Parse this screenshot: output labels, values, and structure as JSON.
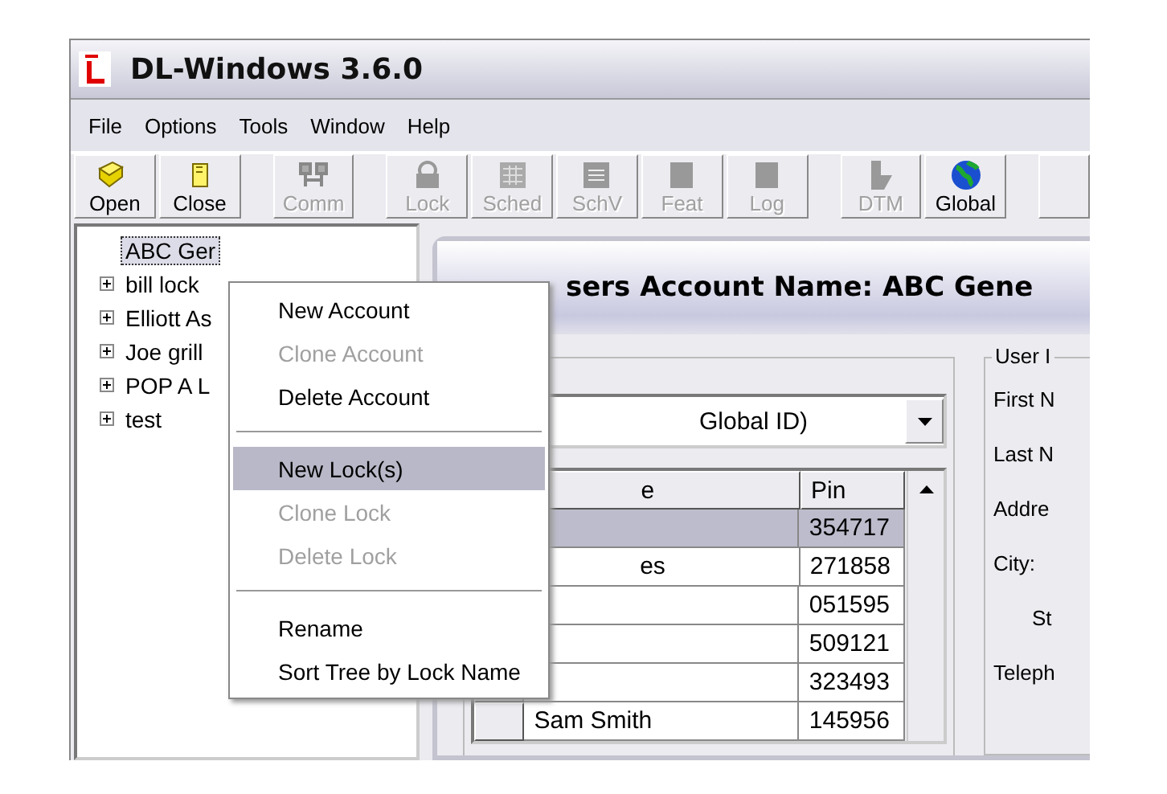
{
  "window": {
    "title": "DL-Windows 3.6.0"
  },
  "menu_bar": [
    "File",
    "Options",
    "Tools",
    "Window",
    "Help"
  ],
  "toolbar": [
    {
      "label": "Open",
      "disabled": false,
      "group_start": false
    },
    {
      "label": "Close",
      "disabled": false,
      "group_start": false
    },
    {
      "label": "Comm",
      "disabled": true,
      "group_start": true
    },
    {
      "label": "Lock",
      "disabled": true,
      "group_start": true
    },
    {
      "label": "Sched",
      "disabled": true,
      "group_start": false
    },
    {
      "label": "SchV",
      "disabled": true,
      "group_start": false
    },
    {
      "label": "Feat",
      "disabled": true,
      "group_start": false
    },
    {
      "label": "Log",
      "disabled": true,
      "group_start": false
    },
    {
      "label": "DTM",
      "disabled": true,
      "group_start": true
    },
    {
      "label": "Global",
      "disabled": false,
      "group_start": false
    }
  ],
  "tree": [
    {
      "label": "ABC Ger",
      "selected": true
    },
    {
      "label": "bill lock",
      "selected": false,
      "expanded": false
    },
    {
      "label": "Elliott As",
      "selected": false,
      "expanded": false
    },
    {
      "label": "Joe grill",
      "selected": false,
      "expanded": false
    },
    {
      "label": "POP A L",
      "selected": false,
      "expanded": false
    },
    {
      "label": "test",
      "selected": false,
      "expanded": false
    }
  ],
  "context_menu": [
    {
      "kind": "item",
      "label": "New Account",
      "disabled": false,
      "selected": false
    },
    {
      "kind": "item",
      "label": "Clone Account",
      "disabled": true,
      "selected": false
    },
    {
      "kind": "item",
      "label": "Delete Account",
      "disabled": false,
      "selected": false
    },
    {
      "kind": "separator"
    },
    {
      "kind": "item",
      "label": "New Lock(s)",
      "disabled": false,
      "selected": true
    },
    {
      "kind": "item",
      "label": "Clone Lock",
      "disabled": true,
      "selected": false
    },
    {
      "kind": "item",
      "label": "Delete Lock",
      "disabled": true,
      "selected": false
    },
    {
      "kind": "separator"
    },
    {
      "kind": "item",
      "label": "Rename",
      "disabled": false,
      "selected": false
    },
    {
      "kind": "item",
      "label": "Sort Tree by Lock Name",
      "disabled": false,
      "selected": false
    }
  ],
  "child_window": {
    "title": "sers Account Name: ABC Gene",
    "dropdown": {
      "value": "Global ID)"
    },
    "table": {
      "columns": [
        {
          "label": "e",
          "covered_by_menu": true
        },
        {
          "label": "Pin",
          "covered_by_menu": false
        }
      ],
      "rows": [
        {
          "pin": "354717",
          "selected": true
        },
        {
          "name": "es",
          "pin": "271858",
          "selected": false,
          "covered_by_menu": true
        },
        {
          "pin": "051595",
          "selected": false
        },
        {
          "pin": "509121",
          "selected": false
        },
        {
          "pin": "323493",
          "selected": false
        },
        {
          "name": "Sam Smith",
          "pin": "145956",
          "selected": false,
          "covered_by_menu": false
        }
      ]
    },
    "user_info": {
      "legend": "User I",
      "labels": [
        "First N",
        "Last N",
        "Addre",
        "City:",
        "St",
        "Teleph"
      ]
    }
  }
}
